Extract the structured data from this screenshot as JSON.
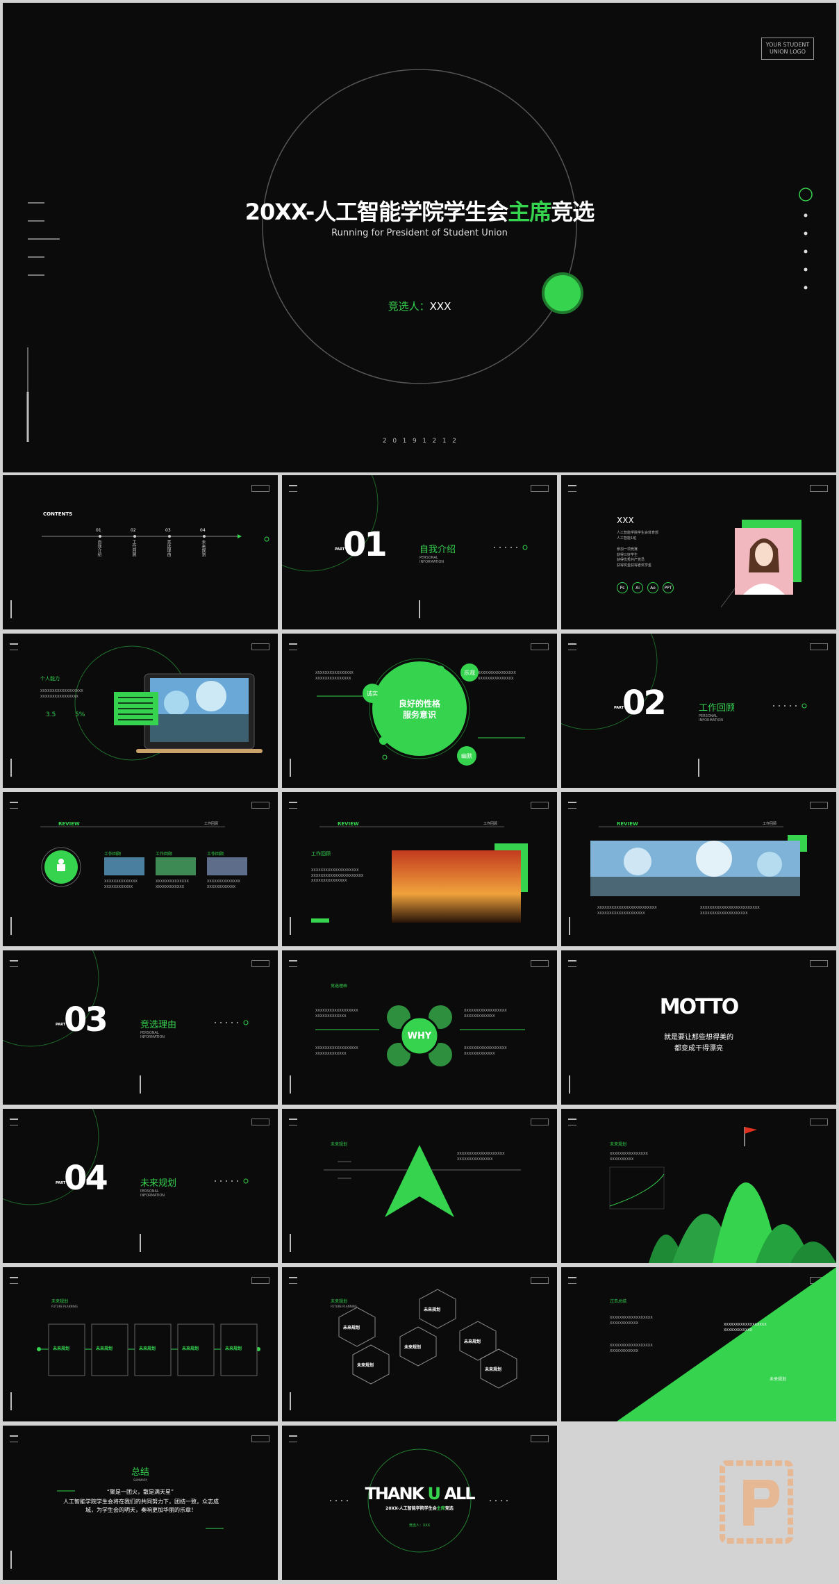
{
  "cover": {
    "title_pre": "20XX-人工智能学院学生会",
    "title_hl": "主席",
    "title_post": "竞选",
    "subtitle": "Running for President of Student Union",
    "candidate_label": "竞选人：",
    "candidate_name": "XXX",
    "logo": "YOUR STUDENT\nUNION LOGO",
    "year_digits": "2   0   1   9   1   2   1   2"
  },
  "contents": {
    "title": "CONTENTS",
    "items": [
      {
        "num": "01",
        "label": "自我介绍"
      },
      {
        "num": "02",
        "label": "工作回顾"
      },
      {
        "num": "03",
        "label": "竞选理由"
      },
      {
        "num": "04",
        "label": "未来规划"
      }
    ]
  },
  "sections": [
    {
      "part": "PART",
      "num": "01",
      "title": "自我介绍",
      "sub": "PERSONAL\nINFORMATION"
    },
    {
      "part": "PART",
      "num": "02",
      "title": "工作回顾",
      "sub": "PERSONAL\nINFORMATION"
    },
    {
      "part": "PART",
      "num": "03",
      "title": "竞选理由",
      "sub": "PERSONAL\nINFORMATION"
    },
    {
      "part": "PART",
      "num": "04",
      "title": "未来规划",
      "sub": "PERSONAL\nINFORMATION"
    }
  ],
  "profile": {
    "name": "XXX",
    "line1": "人工智能学院学生会体育部",
    "line2": "人工智能1班",
    "bullets": [
      "参加一项竞赛",
      "获得三好学生",
      "获得优秀共产党员",
      "获得奖金获得者奖学金"
    ],
    "skills": [
      "Ps",
      "Ai",
      "Ae",
      "PPT"
    ]
  },
  "ability": {
    "title": "个人能力",
    "v1": "3.5",
    "v2": "5%"
  },
  "personality": {
    "center": "良好的性格\n服务意识",
    "tags": [
      "诚实",
      "乐观",
      "幽默"
    ]
  },
  "review": {
    "tag": "REVIEW",
    "right": "工作回顾",
    "cards": [
      "工作回顾",
      "工作回顾",
      "工作回顾"
    ]
  },
  "reasons": {
    "title": "竞选理由",
    "center": "WHY"
  },
  "motto": {
    "title": "MOTTO",
    "line1": "就是要让那些想得美的",
    "line2": "都变成干得漂亮"
  },
  "plan": {
    "title": "未来规划",
    "sub": "FUTURE PLANNING",
    "box_label": "未来规划"
  },
  "summary": {
    "title": "总结",
    "sub": "SUMMARY",
    "quote": "“聚是一团火，散是满天星”",
    "body": "人工智能学院学生会将在我们的共同努力下，团结一致，众志成城，为学生会的明天，奏响更加华丽的乐章！"
  },
  "thanks": {
    "pre": "THANK ",
    "u": "U",
    "post": " ALL",
    "sub_pre": "20XX-人工智能学院学生会",
    "sub_hl": "主席",
    "sub_post": "竞选",
    "cand": "竞选人：XXX"
  },
  "review_label": "过去总结",
  "colors": {
    "accent": "#35d34e",
    "bg": "#0b0b0b",
    "page": "#d3d3d3"
  }
}
